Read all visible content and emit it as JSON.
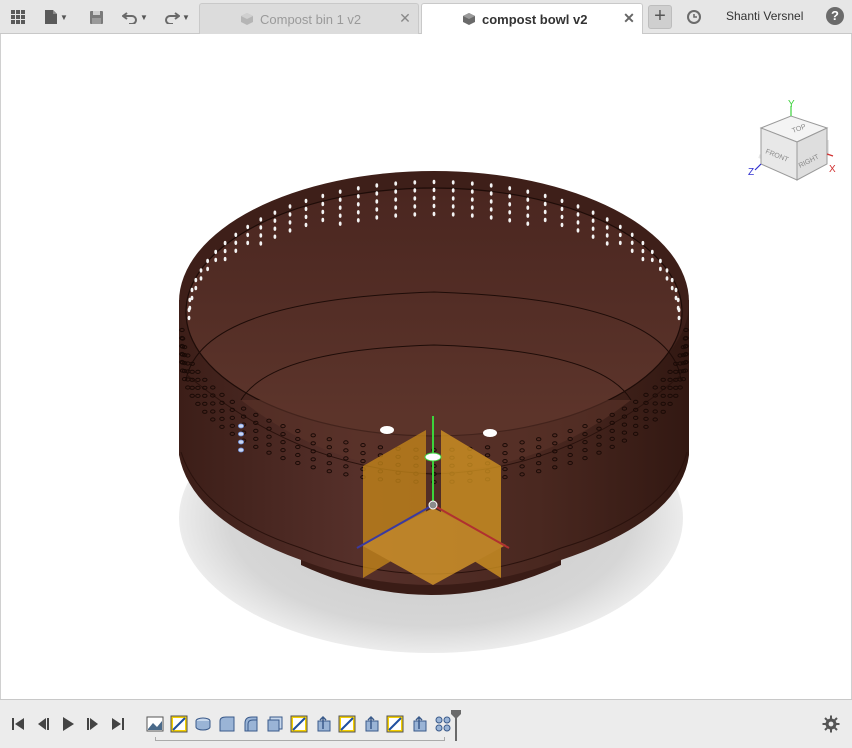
{
  "toolbar": {
    "icons": [
      "grid-icon",
      "file-icon",
      "save-icon",
      "undo-icon",
      "redo-icon"
    ]
  },
  "tabs": [
    {
      "label": "Compost bin 1 v2",
      "active": false,
      "close": "✕"
    },
    {
      "label": "compost bowl v2",
      "active": true,
      "close": "✕"
    }
  ],
  "new_tab": "+",
  "user": {
    "name": "Shanti Versnel"
  },
  "help": "?",
  "viewcube": {
    "top": "TOP",
    "front": "FRONT",
    "right": "RIGHT",
    "axis_x": "X",
    "axis_y": "Y",
    "axis_z": "Z"
  },
  "model": {
    "color": "#4e2a22",
    "rim_color": "#5a3228"
  },
  "timeline": {
    "playback": [
      "first-icon",
      "previous-icon",
      "play-icon",
      "next-icon",
      "last-icon"
    ],
    "feature_count": 13
  }
}
